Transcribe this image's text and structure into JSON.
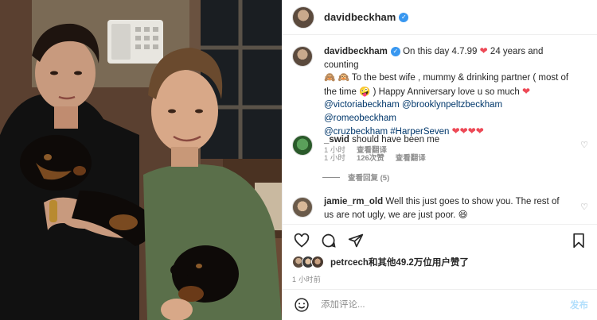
{
  "header": {
    "username": "davidbeckham",
    "verified_icon": "verified-badge-icon"
  },
  "caption": {
    "username": "davidbeckham",
    "text_1": "On this day 4.7.99",
    "text_2": "24 years and counting",
    "text_3": "To the best wife , mummy & drinking partner ( most of the time",
    "text_4": ") Happy Anniversary love u so much",
    "mentions": [
      "@victoriabeckham",
      "@brooklynpeltzbeckham",
      "@romeobeckham",
      "@cruzbeckham",
      "#HarperSeven"
    ],
    "time": "1 小时",
    "translate": "查看翻译"
  },
  "comments": [
    {
      "username": "_swid",
      "text": "should have been me",
      "time": "1 小时",
      "likes": "126次赞",
      "translate": "查看翻译",
      "replies": "查看回复 (5)"
    },
    {
      "username": "jamie_rm_old",
      "text": "Well this just goes to show you. The rest of us are not ugly, we are just poor."
    }
  ],
  "likes": {
    "text": "petrcech和其他49.2万位用户赞了"
  },
  "post_time": "1 小时前",
  "add_comment": {
    "placeholder": "添加评论...",
    "post_label": "发布"
  },
  "colors": {
    "heart": "#ed4956",
    "link": "#00376b",
    "verified": "#3897f0",
    "muted": "#8e8e8e"
  }
}
